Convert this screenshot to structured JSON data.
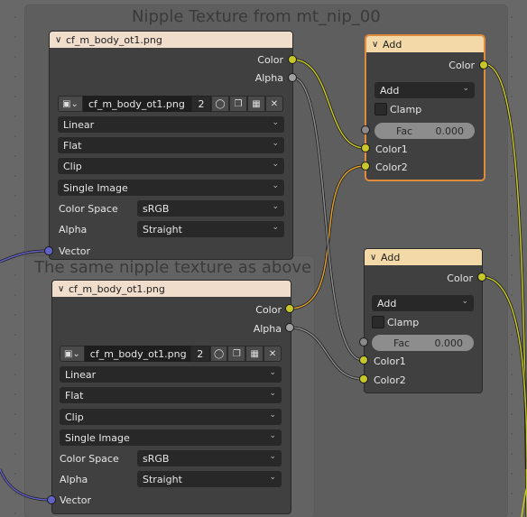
{
  "frames": {
    "top": {
      "label": "Nipple Texture from mt_nip_00"
    },
    "bottom": {
      "label": "The same nipple texture as above"
    }
  },
  "image_nodes": [
    {
      "title": "cf_m_body_ot1.png",
      "out_color": "Color",
      "out_alpha": "Alpha",
      "image_name": "cf_m_body_ot1.png",
      "users": "2",
      "interpolation": "Linear",
      "projection": "Flat",
      "extension": "Clip",
      "source": "Single Image",
      "color_space_label": "Color Space",
      "color_space": "sRGB",
      "alpha_label": "Alpha",
      "alpha_mode": "Straight",
      "in_vector": "Vector"
    },
    {
      "title": "cf_m_body_ot1.png",
      "out_color": "Color",
      "out_alpha": "Alpha",
      "image_name": "cf_m_body_ot1.png",
      "users": "2",
      "interpolation": "Linear",
      "projection": "Flat",
      "extension": "Clip",
      "source": "Single Image",
      "color_space_label": "Color Space",
      "color_space": "sRGB",
      "alpha_label": "Alpha",
      "alpha_mode": "Straight",
      "in_vector": "Vector"
    }
  ],
  "add_nodes": [
    {
      "title": "Add",
      "out_color": "Color",
      "blend_mode": "Add",
      "clamp": "Clamp",
      "fac_label": "Fac",
      "fac_value": "0.000",
      "in_color1": "Color1",
      "in_color2": "Color2"
    },
    {
      "title": "Add",
      "out_color": "Color",
      "blend_mode": "Add",
      "clamp": "Clamp",
      "fac_label": "Fac",
      "fac_value": "0.000",
      "in_color1": "Color1",
      "in_color2": "Color2"
    }
  ],
  "colors": {
    "link_yellow": "#c7c729",
    "link_gray": "#8c8c8c",
    "link_blue": "#6363c7",
    "link_orange": "#e0a030",
    "selected_outline": "#e08a3c"
  }
}
